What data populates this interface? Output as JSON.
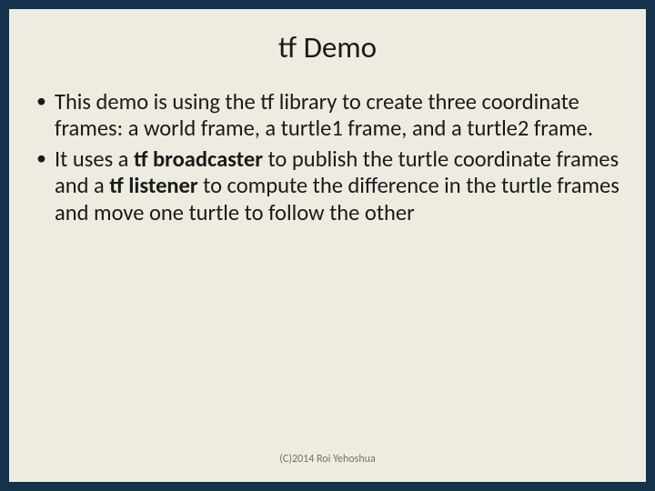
{
  "slide": {
    "title": "tf Demo",
    "bullets": [
      {
        "pre": "This demo is using the tf library to create three coordinate frames: a world frame, a turtle1 frame, and a turtle2 frame.",
        "b1": "",
        "mid1": "",
        "b2": "",
        "mid2": "",
        "tail": ""
      },
      {
        "pre": "It uses a ",
        "b1": "tf broadcaster",
        "mid1": " to publish the turtle coordinate frames and a ",
        "b2": "tf listener",
        "mid2": " to compute the difference in the turtle frames and move one turtle to follow the other",
        "tail": ""
      }
    ],
    "footer": "(C)2014 Roi Yehoshua"
  }
}
